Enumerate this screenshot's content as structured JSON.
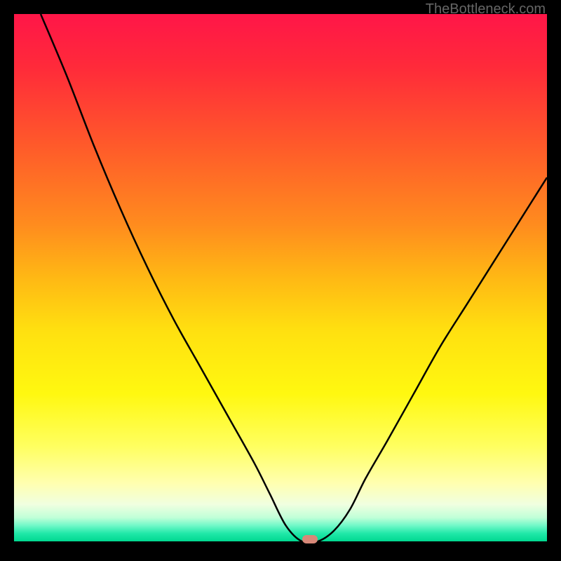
{
  "watermark": "TheBottleneck.com",
  "chart_data": {
    "type": "line",
    "title": "",
    "xlabel": "",
    "ylabel": "",
    "xlim": [
      0,
      100
    ],
    "ylim": [
      0,
      100
    ],
    "gradient_note": "vertical rainbow gradient red(top) to green(bottom)",
    "series": [
      {
        "name": "curve",
        "x": [
          5,
          10,
          15,
          20,
          25,
          30,
          35,
          40,
          45,
          48,
          51,
          54,
          57,
          60,
          63,
          66,
          70,
          75,
          80,
          85,
          90,
          95,
          100
        ],
        "y": [
          100,
          88,
          75,
          63,
          52,
          42,
          33,
          24,
          15,
          9,
          3,
          0,
          0,
          2,
          6,
          12,
          19,
          28,
          37,
          45,
          53,
          61,
          69
        ]
      }
    ],
    "marker": {
      "x": 55.5,
      "y": 0
    }
  }
}
